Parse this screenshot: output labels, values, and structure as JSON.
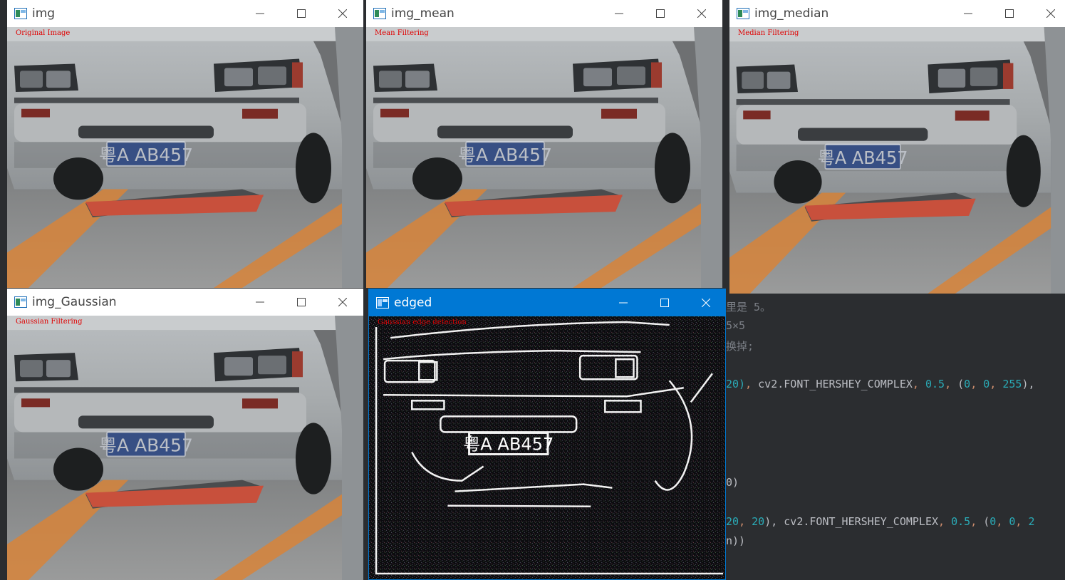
{
  "editor": {
    "lines": [
      {
        "segments": [
          {
            "t": "里是 5。",
            "c": "dim"
          }
        ]
      },
      {
        "segments": [
          {
            "t": "5×5",
            "c": "dim"
          }
        ]
      },
      {
        "segments": [
          {
            "t": "换掉;",
            "c": "dim"
          }
        ]
      },
      {
        "segments": [
          {
            "t": "20)",
            "c": "num"
          },
          {
            "t": ", ",
            "c": "punc"
          },
          {
            "t": "cv2.FONT_HERSHEY_COMPLEX",
            "c": ""
          },
          {
            "t": ", ",
            "c": "punc"
          },
          {
            "t": "0.5",
            "c": "num"
          },
          {
            "t": ", ",
            "c": "punc"
          },
          {
            "t": "(",
            "c": ""
          },
          {
            "t": "0",
            "c": "num"
          },
          {
            "t": ", ",
            "c": "punc"
          },
          {
            "t": "0",
            "c": "num"
          },
          {
            "t": ", ",
            "c": "punc"
          },
          {
            "t": "255",
            "c": "num"
          },
          {
            "t": "),",
            "c": ""
          }
        ]
      },
      {
        "segments": [
          {
            "t": "0)",
            "c": ""
          }
        ]
      },
      {
        "segments": [
          {
            "t": "20",
            "c": "num"
          },
          {
            "t": ", ",
            "c": "punc"
          },
          {
            "t": "20",
            "c": "num"
          },
          {
            "t": "), ",
            "c": ""
          },
          {
            "t": "cv2.FONT_HERSHEY_COMPLEX",
            "c": ""
          },
          {
            "t": ", ",
            "c": "punc"
          },
          {
            "t": "0.5",
            "c": "num"
          },
          {
            "t": ", ",
            "c": "punc"
          },
          {
            "t": "(",
            "c": ""
          },
          {
            "t": "0",
            "c": "num"
          },
          {
            "t": ", ",
            "c": "punc"
          },
          {
            "t": "0",
            "c": "num"
          },
          {
            "t": ", ",
            "c": "punc"
          },
          {
            "t": "2",
            "c": "num"
          }
        ]
      },
      {
        "segments": [
          {
            "t": "n))",
            "c": ""
          }
        ]
      }
    ]
  },
  "windows": {
    "img": {
      "title": "img",
      "overlay": "Original Image",
      "plate": "粤A AB457"
    },
    "img_mean": {
      "title": "img_mean",
      "overlay": "Mean Filtering",
      "plate": "粤A AB457"
    },
    "img_median": {
      "title": "img_median",
      "overlay": "Median Filtering",
      "plate": "粤A AB457"
    },
    "img_gaussian": {
      "title": "img_Gaussian",
      "overlay": "Gaussian Filtering",
      "plate": "粤A AB457"
    },
    "edged": {
      "title": "edged",
      "overlay": "Gaussian edge detection",
      "plate": "粤A AB457"
    }
  },
  "colors": {
    "accent": "#0078d4",
    "overlay_text": "#e00000",
    "plate": "#1c3f8f",
    "floor_stripe": "#d7843a",
    "bumper": "#c8503c"
  }
}
